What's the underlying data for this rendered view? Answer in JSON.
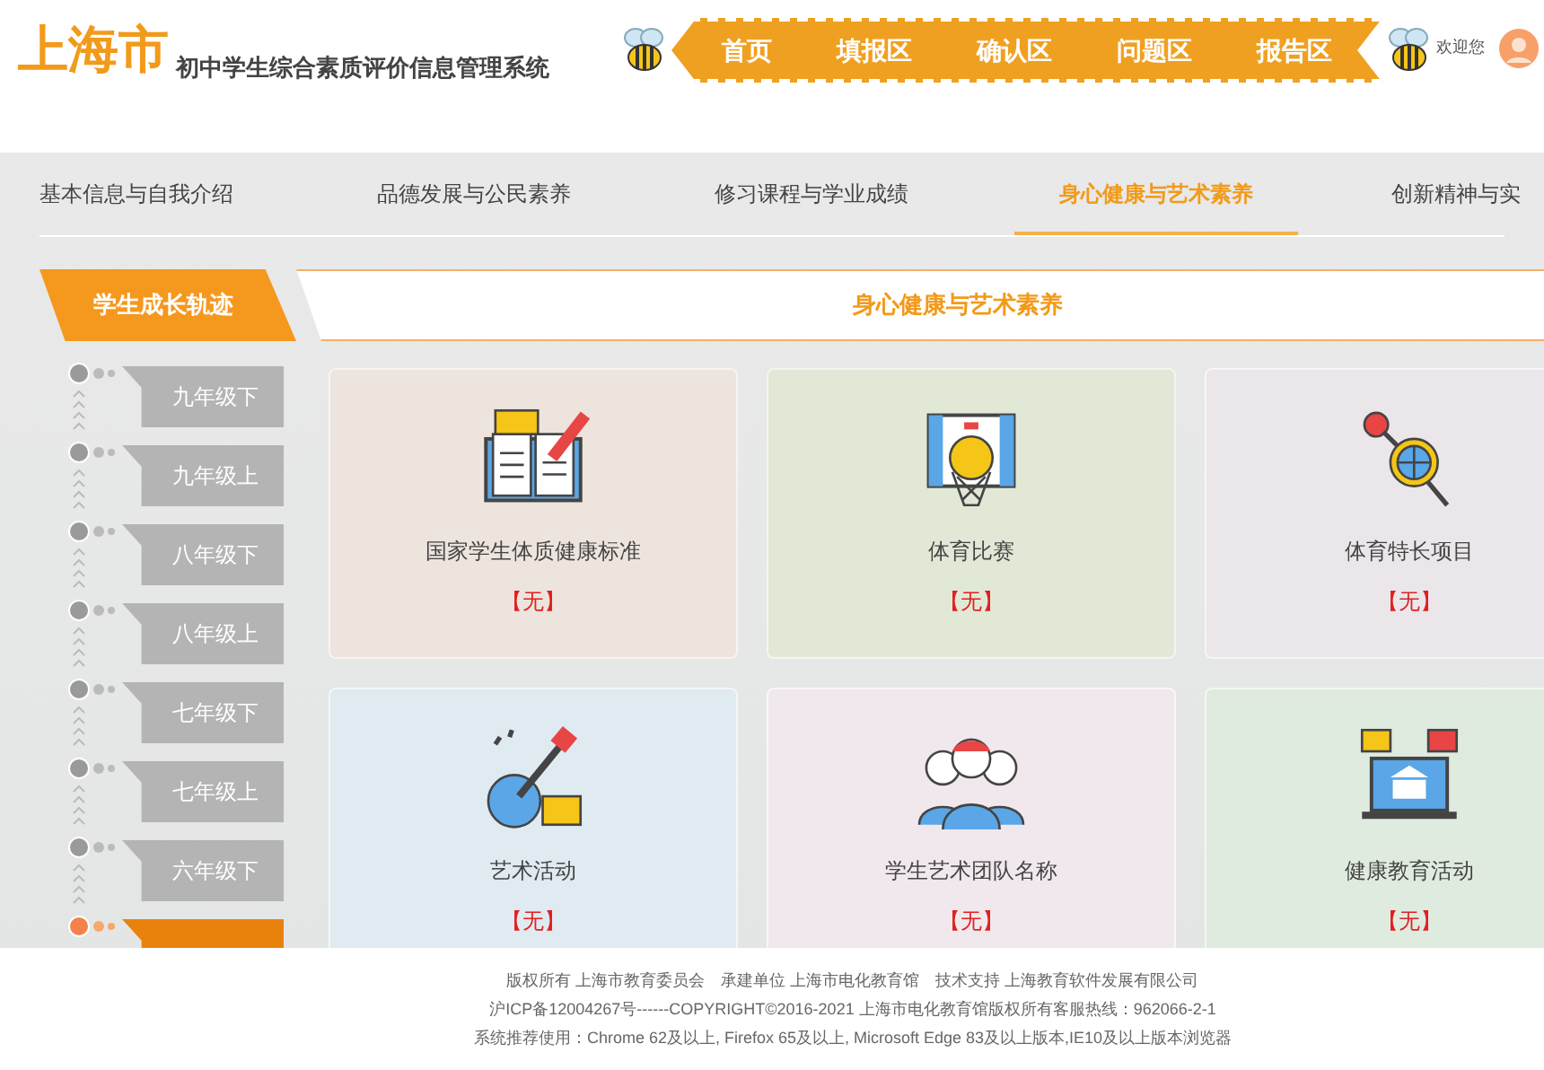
{
  "header": {
    "logo": "上海市",
    "system_title": "初中学生综合素质评价信息管理系统",
    "nav": [
      {
        "label": "首页"
      },
      {
        "label": "填报区"
      },
      {
        "label": "确认区"
      },
      {
        "label": "问题区"
      },
      {
        "label": "报告区"
      }
    ],
    "welcome": "欢迎您"
  },
  "tabs": [
    {
      "label": "基本信息与自我介绍",
      "selected": false
    },
    {
      "label": "品德发展与公民素养",
      "selected": false
    },
    {
      "label": "修习课程与学业成绩",
      "selected": false
    },
    {
      "label": "身心健康与艺术素养",
      "selected": true
    },
    {
      "label": "创新精神与实",
      "selected": false
    }
  ],
  "sidebar": {
    "title": "学生成长轨迹",
    "items": [
      {
        "label": "九年级下",
        "selected": false
      },
      {
        "label": "九年级上",
        "selected": false
      },
      {
        "label": "八年级下",
        "selected": false
      },
      {
        "label": "八年级上",
        "selected": false
      },
      {
        "label": "七年级下",
        "selected": false
      },
      {
        "label": "七年级上",
        "selected": false
      },
      {
        "label": "六年级下",
        "selected": false
      },
      {
        "selected": true
      }
    ]
  },
  "section_title": "身心健康与艺术素养",
  "cards": [
    {
      "kind": "book",
      "title": "国家学生体质健康标准",
      "status": "【无】",
      "color": "#ece4dd"
    },
    {
      "kind": "basketball",
      "title": "体育比赛",
      "status": "【无】",
      "color": "#e2e8d6"
    },
    {
      "kind": "globe",
      "title": "体育特长项目",
      "status": "【无】",
      "color": "#ebe6ea"
    },
    {
      "kind": "guitar",
      "title": "艺术活动",
      "status": "【无】",
      "color": "#e0eaf1"
    },
    {
      "kind": "team",
      "title": "学生艺术团队名称",
      "status": "【无】",
      "color": "#f1e8ee"
    },
    {
      "kind": "laptop",
      "title": "健康教育活动",
      "status": "【无】",
      "color": "#e0ebe0"
    }
  ],
  "footer": [
    "版权所有 上海市教育委员会　承建单位 上海市电化教育馆　技术支持 上海教育软件发展有限公司",
    "沪ICP备12004267号------COPYRIGHT©2016-2021 上海市电化教育馆版权所有客服热线：962066-2-1",
    "系统推荐使用：Chrome 62及以上, Firefox 65及以上, Microsoft Edge 83及以上版本,IE10及以上版本浏览器"
  ]
}
